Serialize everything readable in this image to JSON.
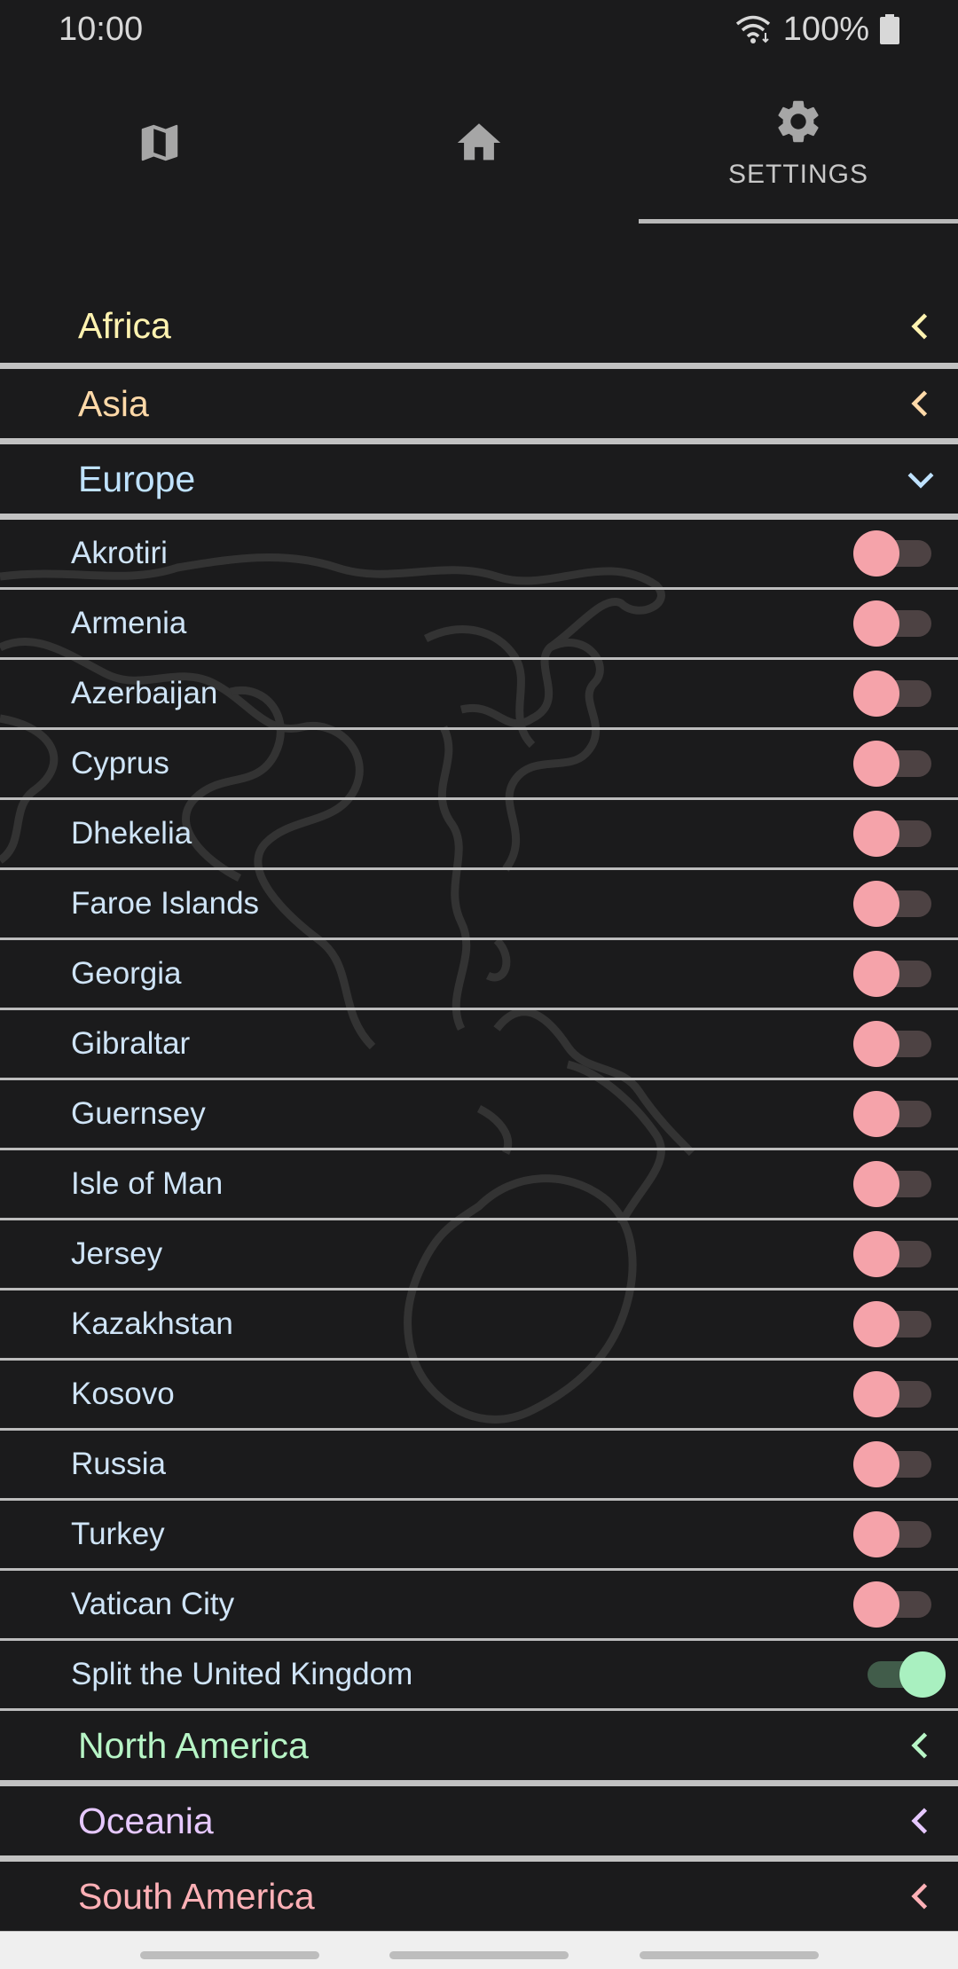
{
  "status_bar": {
    "time": "10:00",
    "battery": "100%"
  },
  "nav": {
    "tabs": [
      {
        "id": "map",
        "icon": "map-icon",
        "label": ""
      },
      {
        "id": "home",
        "icon": "home-icon",
        "label": ""
      },
      {
        "id": "settings",
        "icon": "gear-icon",
        "label": "SETTINGS",
        "active": true
      }
    ]
  },
  "regions": {
    "africa": {
      "name": "Africa",
      "color": "#fff3b0",
      "expanded": false
    },
    "asia": {
      "name": "Asia",
      "color": "#ffd9a8",
      "expanded": false
    },
    "europe": {
      "name": "Europe",
      "color": "#bfe2ff",
      "expanded": true
    },
    "north_america": {
      "name": "North America",
      "color": "#b7f5c6",
      "expanded": false
    },
    "oceania": {
      "name": "Oceania",
      "color": "#e6c8ff",
      "expanded": false
    },
    "south_america": {
      "name": "South America",
      "color": "#ffb0b6",
      "expanded": false
    }
  },
  "europe_items": [
    {
      "name": "Akrotiri",
      "on": false
    },
    {
      "name": "Armenia",
      "on": false
    },
    {
      "name": "Azerbaijan",
      "on": false
    },
    {
      "name": "Cyprus",
      "on": false
    },
    {
      "name": "Dhekelia",
      "on": false
    },
    {
      "name": "Faroe Islands",
      "on": false
    },
    {
      "name": "Georgia",
      "on": false
    },
    {
      "name": "Gibraltar",
      "on": false
    },
    {
      "name": "Guernsey",
      "on": false
    },
    {
      "name": "Isle of Man",
      "on": false
    },
    {
      "name": "Jersey",
      "on": false
    },
    {
      "name": "Kazakhstan",
      "on": false
    },
    {
      "name": "Kosovo",
      "on": false
    },
    {
      "name": "Russia",
      "on": false
    },
    {
      "name": "Turkey",
      "on": false
    },
    {
      "name": "Vatican City",
      "on": false
    },
    {
      "name": "Split the United Kingdom",
      "on": true
    }
  ]
}
